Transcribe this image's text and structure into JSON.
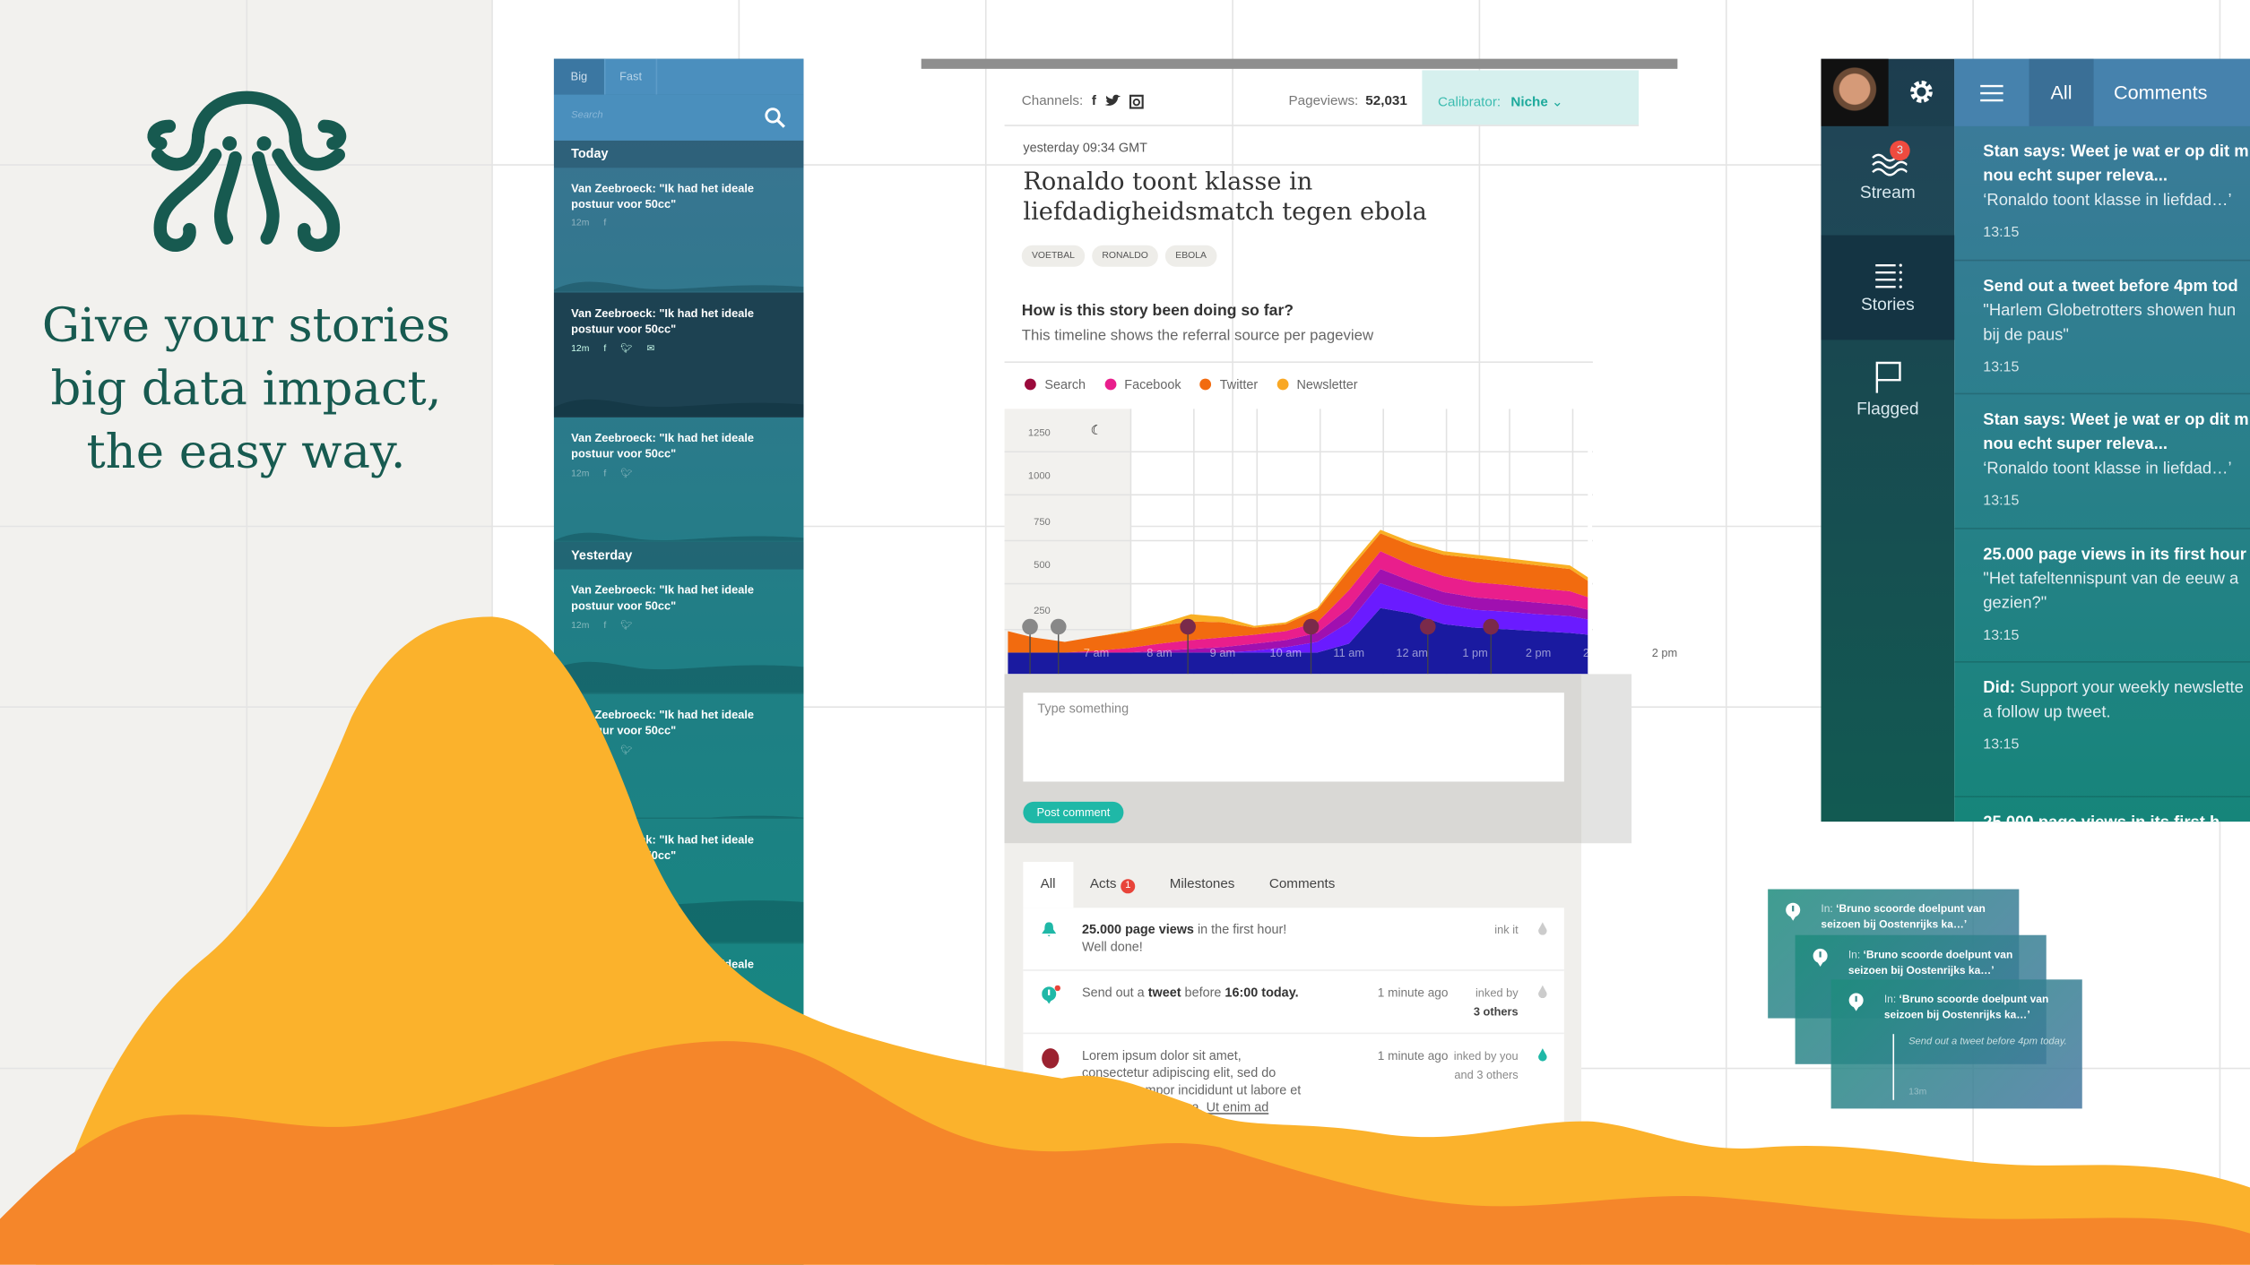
{
  "hero": {
    "headline_lines": [
      "Give your stories",
      "big data impact,",
      "the easy way."
    ],
    "brand_color": "#175a50",
    "logo": "octopus-logo"
  },
  "story_list": {
    "tabs": [
      {
        "label": "Big",
        "active": true
      },
      {
        "label": "Fast",
        "active": false
      }
    ],
    "search_placeholder": "Search",
    "sections": [
      {
        "label": "Today",
        "items": [
          {
            "title": "Van Zeebroeck: \"Ik had het ideale postuur voor 50cc\"",
            "age": "12m",
            "channels": [
              "facebook"
            ]
          },
          {
            "title": "Van Zeebroeck: \"Ik had het ideale postuur voor 50cc\"",
            "age": "12m",
            "channels": [
              "facebook",
              "twitter",
              "mail"
            ],
            "selected": true
          },
          {
            "title": "Van Zeebroeck: \"Ik had het ideale postuur voor 50cc\"",
            "age": "12m",
            "channels": [
              "facebook",
              "twitter"
            ]
          }
        ]
      },
      {
        "label": "Yesterday",
        "items": [
          {
            "title": "Van Zeebroeck: \"Ik had het ideale postuur voor 50cc\"",
            "age": "12m",
            "channels": [
              "facebook",
              "twitter"
            ]
          },
          {
            "title": "Van Zeebroeck: \"Ik had het ideale postuur voor 50cc\"",
            "age": "12m",
            "channels": [
              "facebook",
              "twitter"
            ]
          },
          {
            "title": "Van Zeebroeck: \"Ik had het ideale postuur voor 50cc\"",
            "age": "",
            "channels": []
          },
          {
            "title": "Van Zeebroeck: \"Ik had het ideale postuur voor 50cc\"",
            "age": "",
            "channels": []
          }
        ]
      }
    ]
  },
  "story": {
    "channels_label": "Channels:",
    "pageviews_label": "Pageviews:",
    "pageviews": "52,031",
    "calibrator_label": "Calibrator:",
    "calibrator_value": "Niche",
    "date": "yesterday 09:34 GMT",
    "title_lines": [
      "Ronaldo toont klasse in",
      "liefdadigheidsmatch tegen ebola"
    ],
    "tags": [
      "VOETBAL",
      "RONALDO",
      "EBOLA"
    ],
    "question": "How is this story been doing so far?",
    "subtitle": "This timeline shows the referral source per pageview",
    "comment_placeholder": "Type something",
    "post_label": "Post comment",
    "accent": "#1fb8a7"
  },
  "chart_data": {
    "type": "area",
    "stacked": true,
    "legend": [
      {
        "name": "Search",
        "color": "#9b0a3c"
      },
      {
        "name": "Facebook",
        "color": "#e91e8c"
      },
      {
        "name": "Twitter",
        "color": "#f26b0f"
      },
      {
        "name": "Newsletter",
        "color": "#f9a825"
      }
    ],
    "legend_placement": "top-left",
    "y_ticks": [
      "1250",
      "1000",
      "750",
      "500",
      "250"
    ],
    "ylim": [
      0,
      1250
    ],
    "x_tick_labels": [
      "7 am",
      "8 am",
      "9 am",
      "10 am",
      "11 am",
      "12 am",
      "1 pm",
      "2 pm",
      "2 pm",
      "2 pm"
    ],
    "x_hours": [
      5.6,
      6.0,
      6.5,
      7,
      7.5,
      8,
      8.5,
      9,
      9.5,
      10,
      10.5,
      11,
      11.5,
      12,
      12.5,
      13,
      13.5,
      14,
      14.5,
      14.8
    ],
    "series": [
      {
        "color": "#1a1aa0",
        "values": [
          0,
          0,
          0,
          0,
          0,
          0,
          0,
          0,
          0,
          0,
          0,
          50,
          250,
          220,
          160,
          140,
          130,
          120,
          110,
          100
        ]
      },
      {
        "color": "#6a1bff",
        "values": [
          0,
          0,
          0,
          0,
          0,
          0,
          0,
          0,
          10,
          30,
          60,
          120,
          140,
          110,
          110,
          100,
          100,
          95,
          95,
          85
        ]
      },
      {
        "color": "#a010b0",
        "values": [
          0,
          0,
          0,
          0,
          0,
          10,
          20,
          30,
          40,
          40,
          50,
          80,
          80,
          70,
          70,
          70,
          65,
          65,
          60,
          55
        ]
      },
      {
        "color": "#e91e8c",
        "values": [
          0,
          0,
          0,
          10,
          25,
          40,
          50,
          55,
          50,
          50,
          60,
          100,
          100,
          90,
          90,
          85,
          85,
          80,
          80,
          70
        ]
      },
      {
        "color": "#f26b0f",
        "values": [
          120,
          85,
          60,
          80,
          90,
          100,
          105,
          85,
          40,
          40,
          70,
          110,
          100,
          110,
          120,
          135,
          130,
          130,
          125,
          90
        ]
      },
      {
        "color": "#f9b025",
        "values": [
          0,
          0,
          0,
          0,
          5,
          10,
          40,
          30,
          10,
          10,
          10,
          20,
          20,
          20,
          20,
          20,
          20,
          20,
          20,
          20
        ]
      }
    ],
    "markers": [
      {
        "hour": 5.95,
        "icon": "home"
      },
      {
        "hour": 6.4,
        "icon": "facebook"
      },
      {
        "hour": 8.45,
        "icon": "twitter"
      },
      {
        "hour": 10.4,
        "icon": "youtube"
      },
      {
        "hour": 12.25,
        "icon": "mail"
      },
      {
        "hour": 13.25,
        "icon": "link"
      }
    ],
    "grid": true
  },
  "activity": {
    "tabs": [
      {
        "label": "All",
        "active": true
      },
      {
        "label": "Acts",
        "badge": "1"
      },
      {
        "label": "Milestones"
      },
      {
        "label": "Comments"
      }
    ],
    "rows": [
      {
        "icon": "bell",
        "bold": "25.000 page views",
        "text": " in the first hour!",
        "line2": "Well done!",
        "time": "",
        "ink1": "ink it",
        "ink2": ""
      },
      {
        "icon": "alert",
        "pre": "Send out a ",
        "bold": "tweet",
        "text": " before ",
        "bold2": "16:00 today.",
        "time": "1 minute ago",
        "ink1": "inked by",
        "ink2": "3 others"
      },
      {
        "icon": "avatar",
        "text": "Lorem ipsum dolor sit amet,",
        "line2": "consectetur adipiscing elit, sed do",
        "line3": "eiusmod tempor incididunt ut labore et",
        "line4": "dolore magna aliqua. Ut enim ad",
        "time": "1 minute ago",
        "ink1": "inked by you",
        "ink2": "and 3 others"
      }
    ]
  },
  "app": {
    "nav": [
      {
        "label": "Stream",
        "icon": "waves",
        "badge": "3"
      },
      {
        "label": "Stories",
        "icon": "list",
        "active": true
      },
      {
        "label": "Flagged",
        "icon": "flag"
      }
    ],
    "tabs": [
      {
        "label": "All",
        "active": true
      },
      {
        "label": "Comments"
      }
    ],
    "feed": [
      {
        "bold": "Stan says: Weet je wat er op dit m",
        "bold2": "nou echt super releva...",
        "text": "‘Ronaldo toont klasse in liefdad…’",
        "time": "13:15"
      },
      {
        "bold": "Send out a tweet before 4pm tod",
        "text": "\"Harlem Globetrotters showen hun",
        "text2": "bij de paus\"",
        "time": "13:15"
      },
      {
        "bold": "Stan says: Weet je wat er op dit m",
        "bold2": "nou echt super releva...",
        "text": "‘Ronaldo toont klasse in liefdad…’",
        "time": "13:15"
      },
      {
        "bold": "25.000 page views in its first hour",
        "text": "\"Het tafeltennispunt van de eeuw a",
        "text2": "gezien?\"",
        "time": "13:15"
      },
      {
        "bold": "Did:",
        "text": " Support your weekly newslette",
        "text2": "a follow up tweet.",
        "time": "13:15"
      },
      {
        "bold": "25.000 page views in its first h",
        "time": ""
      }
    ]
  },
  "notifications": [
    {
      "in": "In: ",
      "title": "‘Bruno scoorde doelpunt van seizoen bij Oostenrijks ka…’"
    },
    {
      "in": "In: ",
      "title": "‘Bruno scoorde doelpunt van seizoen bij Oostenrijks ka…’"
    },
    {
      "in": "In: ",
      "title": "‘Bruno scoorde doelpunt van seizoen bij Oostenrijks ka…’",
      "note": "Send out a tweet before 4pm today.",
      "age": "13m"
    }
  ],
  "colors": {
    "yellow": "#fbb22c",
    "orange": "#f5862a",
    "teal": "#1fb8a7"
  }
}
